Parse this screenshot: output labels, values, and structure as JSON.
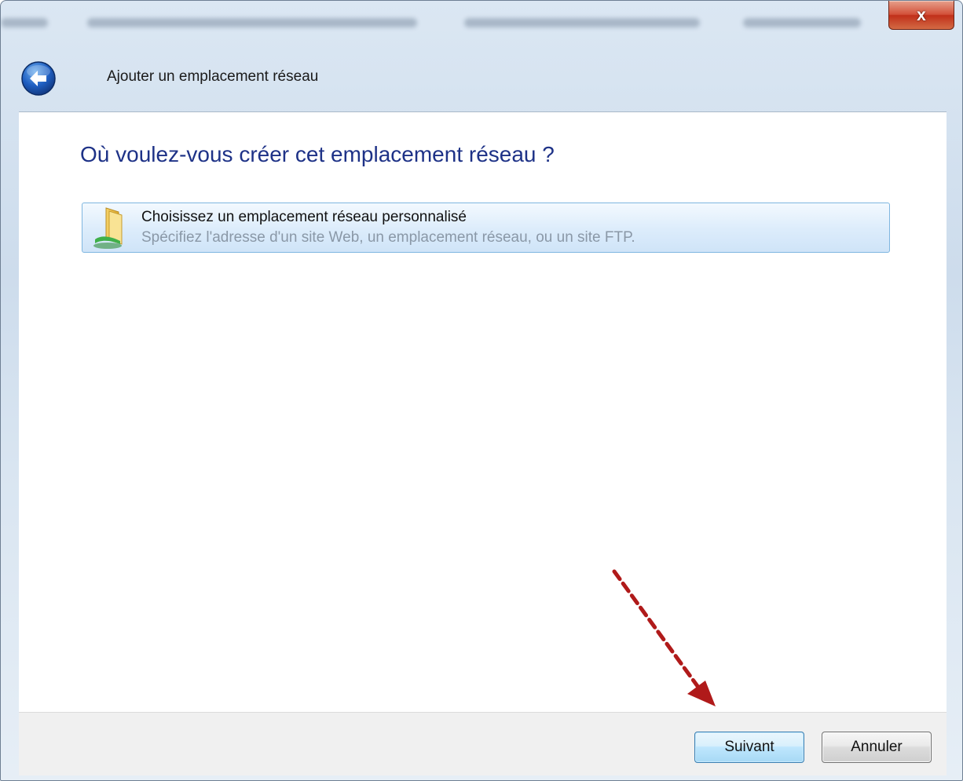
{
  "window": {
    "title": "Ajouter un emplacement réseau",
    "close_glyph": "x"
  },
  "icons": {
    "back": "back-arrow-icon",
    "close": "close-icon",
    "network_folder": "network-folder-icon"
  },
  "main": {
    "heading": "Où voulez-vous créer cet emplacement réseau ?",
    "option": {
      "title": "Choisissez un emplacement réseau personnalisé",
      "description": "Spécifiez l'adresse d'un site Web, un emplacement réseau, ou un site FTP."
    }
  },
  "footer": {
    "next_label": "Suivant",
    "cancel_label": "Annuler"
  },
  "colors": {
    "heading": "#1e3287",
    "option_border": "#7fb6e0",
    "arrow": "#b01a1a"
  }
}
